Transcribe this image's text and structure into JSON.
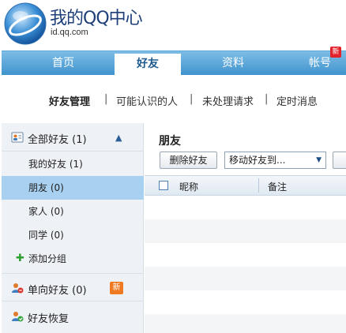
{
  "brand": {
    "title": "我的QQ中心",
    "url": "id.qq.com"
  },
  "nav": {
    "tabs": [
      {
        "label": "首页",
        "active": false
      },
      {
        "label": "好友",
        "active": true
      },
      {
        "label": "资料",
        "active": false
      },
      {
        "label": "帐号",
        "active": false,
        "badge": "新"
      }
    ]
  },
  "subnav": {
    "items": [
      {
        "label": "好友管理",
        "active": true
      },
      {
        "label": "可能认识的人",
        "active": false
      },
      {
        "label": "未处理请求",
        "active": false
      },
      {
        "label": "定时消息",
        "active": false
      }
    ],
    "separator": "|"
  },
  "sidebar": {
    "all_friends": {
      "label": "全部好友 (1)",
      "icon": "friends-card-icon",
      "expanded": true
    },
    "groups": [
      {
        "label": "我的好友 (1)",
        "selected": false
      },
      {
        "label": "朋友 (0)",
        "selected": true
      },
      {
        "label": "家人 (0)",
        "selected": false
      },
      {
        "label": "同学 (0)",
        "selected": false
      }
    ],
    "add_group": {
      "label": "添加分组",
      "icon": "plus-icon"
    },
    "one_way": {
      "label": "单向好友 (0)",
      "badge": "新",
      "icon": "one-way-friends-icon"
    },
    "recover": {
      "label": "好友恢复",
      "icon": "friend-recover-icon"
    }
  },
  "content": {
    "title": "朋友",
    "delete_button": "删除好友",
    "move_select": "移动好友到...",
    "columns": [
      "昵称",
      "备注"
    ]
  },
  "colors": {
    "nav_top": "#7ebde6",
    "nav_bottom": "#3f93cd",
    "selected_row": "#a8d0f0",
    "sidebar_bg": "#eef1f5",
    "badge_red": "#e2232a",
    "badge_orange": "#ef7a22"
  }
}
